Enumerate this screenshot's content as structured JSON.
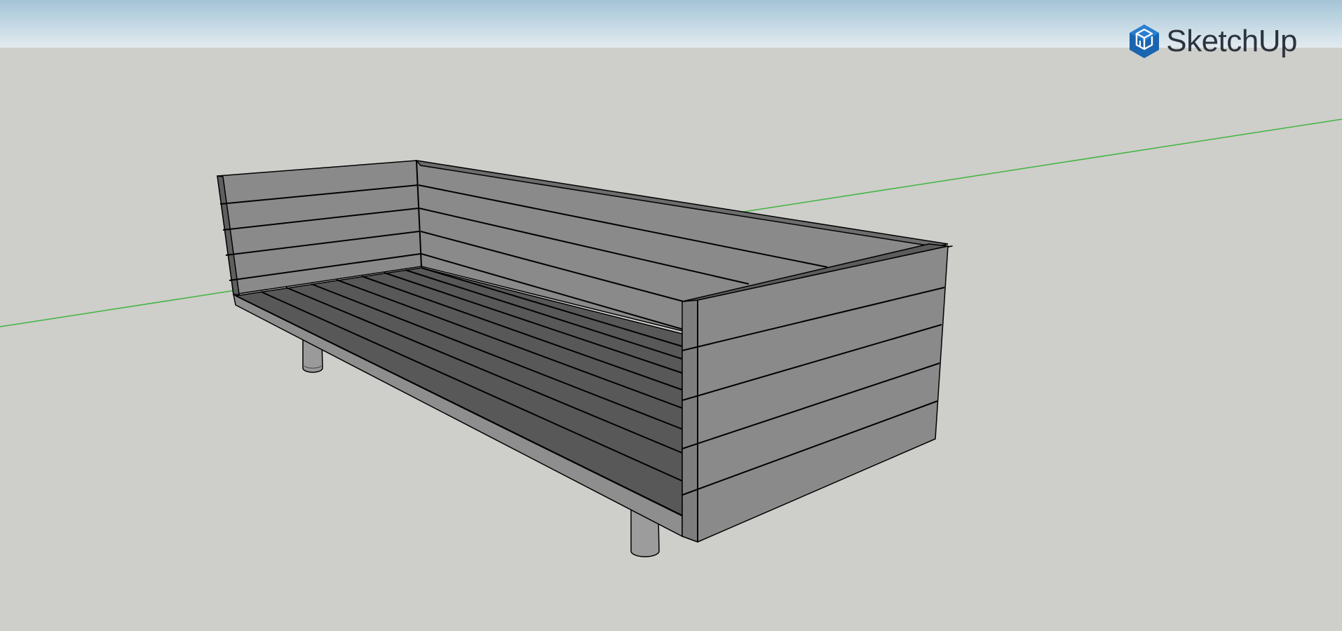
{
  "app": {
    "name": "SketchUp",
    "logo_icon": "sketchup-logo-icon"
  },
  "viewport": {
    "sky_color": "#b4cfdc",
    "ground_color": "#cececa",
    "green_axis_color": "#3fb53f"
  },
  "model": {
    "object": "sofa-frame",
    "face_color": "#888888",
    "seat_color": "#575757",
    "edge_color": "#000000"
  }
}
